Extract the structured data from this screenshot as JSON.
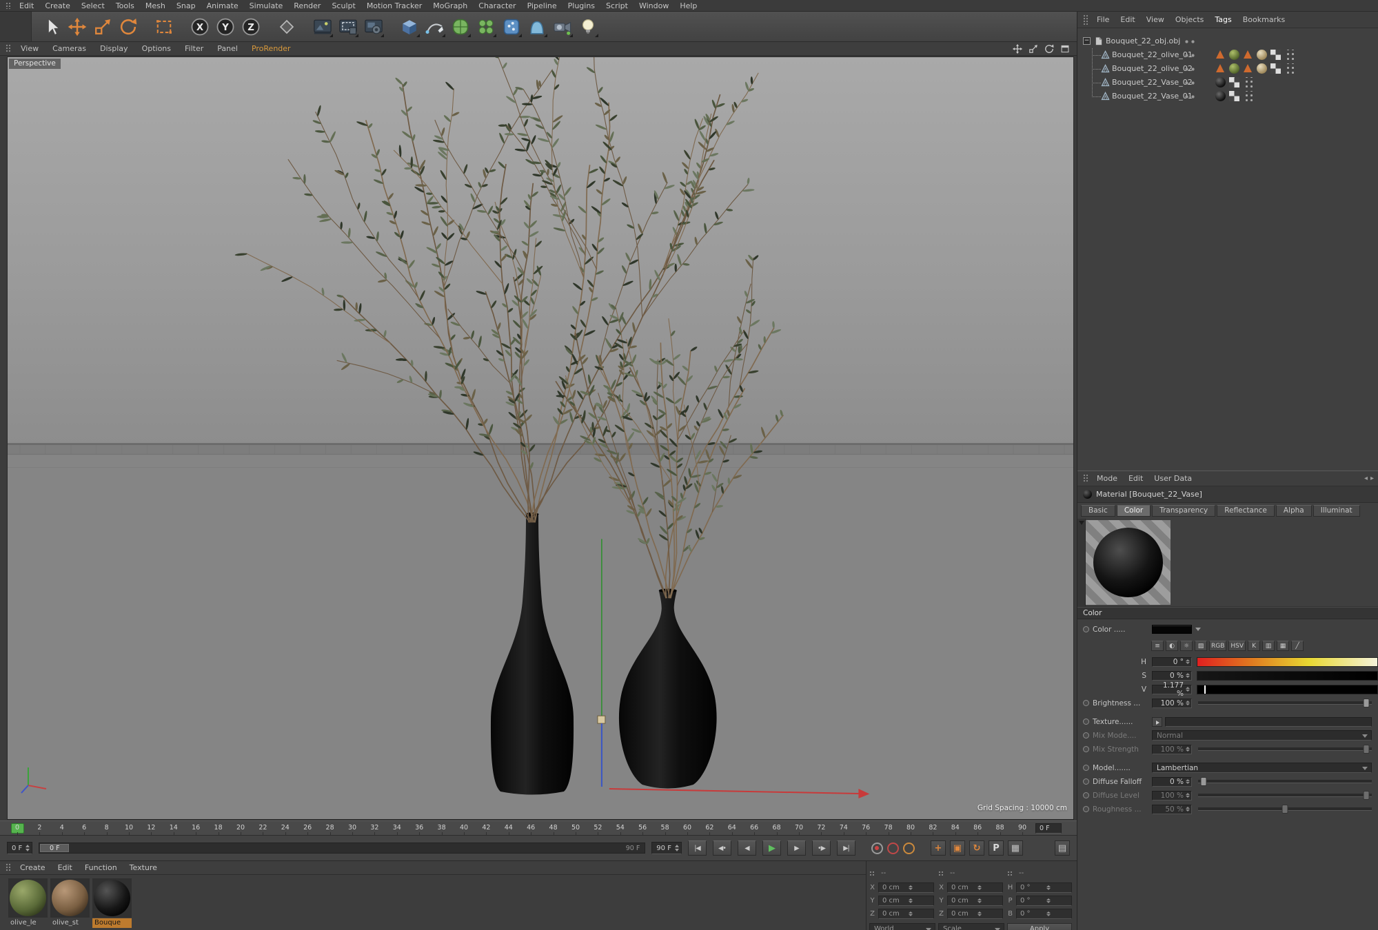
{
  "app": {
    "camera_label": "Perspective",
    "grid_spacing": "Grid Spacing : 10000 cm"
  },
  "colors": {
    "accent_orange": "#e0873c",
    "play_green": "#5fbf5f",
    "marker_green": "#56b34e",
    "selected_material_highlight": "#bd7b2e"
  },
  "menubar": {
    "items": [
      "Edit",
      "Create",
      "Select",
      "Tools",
      "Mesh",
      "Snap",
      "Animate",
      "Simulate",
      "Render",
      "Sculpt",
      "Motion Tracker",
      "MoGraph",
      "Character",
      "Pipeline",
      "Plugins",
      "Script",
      "Window",
      "Help"
    ]
  },
  "toolbar": {
    "icons": [
      {
        "name": "live-selection-tool",
        "kind": "cursor"
      },
      {
        "name": "move-tool",
        "kind": "move",
        "color": "#e0873c"
      },
      {
        "name": "scale-tool",
        "kind": "scale",
        "color": "#e0873c"
      },
      {
        "name": "rotate-tool",
        "kind": "rotate",
        "color": "#e0873c"
      },
      {
        "name": "last-used-tool",
        "kind": "recttool",
        "gap": true
      },
      {
        "name": "x-axis-lock",
        "kind": "axis",
        "label": "X",
        "gap": true
      },
      {
        "name": "y-axis-lock",
        "kind": "axis",
        "label": "Y"
      },
      {
        "name": "z-axis-lock",
        "kind": "axis",
        "label": "Z"
      },
      {
        "name": "coordinate-system-toggle",
        "kind": "coordsys",
        "gap": true
      },
      {
        "name": "render-view",
        "kind": "render",
        "gap": true,
        "fly": true
      },
      {
        "name": "render-region",
        "kind": "render2",
        "fly": true
      },
      {
        "name": "render-settings",
        "kind": "render3",
        "fly": true
      },
      {
        "name": "add-cube-object",
        "kind": "cube",
        "gap": true,
        "fly": true
      },
      {
        "name": "add-spline-pen",
        "kind": "pen",
        "fly": true
      },
      {
        "name": "add-subdivision-surface",
        "kind": "subdiv",
        "fly": true
      },
      {
        "name": "add-array-generator",
        "kind": "array",
        "fly": true
      },
      {
        "name": "add-volume",
        "kind": "volume",
        "fly": true
      },
      {
        "name": "add-deformer",
        "kind": "deformer",
        "fly": true
      },
      {
        "name": "add-camera",
        "kind": "camera",
        "fly": true
      },
      {
        "name": "add-light",
        "kind": "light",
        "fly": true
      }
    ]
  },
  "viewport_menu": {
    "items": [
      "View",
      "Cameras",
      "Display",
      "Options",
      "Filter",
      "Panel",
      "ProRender"
    ],
    "highlight": "ProRender",
    "view_icons": [
      {
        "name": "viewport-pan",
        "kind": "move"
      },
      {
        "name": "viewport-zoom",
        "kind": "scale"
      },
      {
        "name": "viewport-rotate",
        "kind": "rotate"
      },
      {
        "name": "viewport-toggle",
        "kind": "maximize"
      }
    ]
  },
  "object_manager": {
    "menu": [
      "File",
      "Edit",
      "View",
      "Objects",
      "Tags",
      "Bookmarks"
    ],
    "active": "Tags",
    "expand_glyph": "−",
    "rows": [
      {
        "name": "Bouquet_22_obj.obj",
        "root": true,
        "icon": "objfile",
        "tags": []
      },
      {
        "name": "Bouquet_22_olive_01",
        "icon": "mesh",
        "tags": [
          "tri",
          "matGreen",
          "tri",
          "matTan",
          "uvw",
          "dots"
        ]
      },
      {
        "name": "Bouquet_22_olive_02",
        "icon": "mesh",
        "tags": [
          "tri",
          "matGreen",
          "tri",
          "matTan",
          "uvw",
          "dots"
        ]
      },
      {
        "name": "Bouquet_22_Vase_02",
        "icon": "mesh",
        "tags": [
          "matBlack",
          "uvw",
          "dots"
        ]
      },
      {
        "name": "Bouquet_22_Vase_01",
        "icon": "mesh",
        "tags": [
          "matBlack",
          "uvw",
          "dots"
        ]
      }
    ]
  },
  "attributes": {
    "menu": [
      "Mode",
      "Edit",
      "User Data"
    ],
    "nav_back": "◂",
    "nav_fwd": "▸",
    "title": "Material [Bouquet_22_Vase]",
    "tabs": [
      "Basic",
      "Color",
      "Transparency",
      "Reflectance",
      "Alpha",
      "Illuminat"
    ],
    "active_tab": "Color",
    "section": "Color",
    "color_tools": [
      {
        "name": "compact-toggle-icon",
        "glyph": "≡"
      },
      {
        "name": "color-wheel-icon",
        "glyph": "◐"
      },
      {
        "name": "spectrum-icon",
        "glyph": "☼"
      },
      {
        "name": "picture-icon",
        "glyph": "▨"
      },
      {
        "name": "rgb-mode-button",
        "glyph": "RGB"
      },
      {
        "name": "hsv-mode-button",
        "glyph": "HSV"
      },
      {
        "name": "kelvin-mode-button",
        "glyph": "K"
      },
      {
        "name": "mixer-icon",
        "glyph": "▥"
      },
      {
        "name": "swatches-icon",
        "glyph": "▦"
      },
      {
        "name": "picker-icon",
        "glyph": "╱"
      }
    ],
    "params": [
      {
        "name": "color",
        "label": "Color .....",
        "type": "swatch",
        "dot": true
      },
      {
        "name": "color-tools",
        "type": "icons"
      },
      {
        "name": "hue",
        "label": "H",
        "short": true,
        "value": "0 °",
        "type": "gradient",
        "gradient": "hue"
      },
      {
        "name": "saturation",
        "label": "S",
        "short": true,
        "value": "0 %",
        "type": "gradient",
        "gradient": "sat"
      },
      {
        "name": "value",
        "label": "V",
        "short": true,
        "value": "1.177 %",
        "type": "gradient",
        "gradient": "val",
        "marker": 0.04
      },
      {
        "name": "brightness",
        "label": "Brightness ...",
        "value": "100 %",
        "type": "slider",
        "pos": 0.97,
        "dot": true
      },
      {
        "name": "texture",
        "label": "Texture......",
        "type": "texture",
        "dot": true,
        "gap": true
      },
      {
        "name": "mix-mode",
        "label": "Mix Mode....",
        "value": "Normal",
        "type": "dropdown",
        "disabled": true,
        "dot": true
      },
      {
        "name": "mix-strength",
        "label": "Mix Strength",
        "value": "100 %",
        "type": "slider",
        "pos": 0.97,
        "disabled": true,
        "dot": true
      },
      {
        "name": "model",
        "label": "Model.......",
        "value": "Lambertian",
        "type": "dropdown",
        "dot": true,
        "gap": true
      },
      {
        "name": "diffuse-falloff",
        "label": "Diffuse Falloff",
        "value": "0 %",
        "type": "slider",
        "pos": 0.03,
        "dot": true
      },
      {
        "name": "diffuse-level",
        "label": "Diffuse Level",
        "value": "100 %",
        "type": "slider",
        "pos": 0.97,
        "disabled": true,
        "dot": true
      },
      {
        "name": "roughness",
        "label": "Roughness ...",
        "value": "50 %",
        "type": "slider",
        "pos": 0.5,
        "disabled": true,
        "dot": true
      }
    ]
  },
  "timeline": {
    "labels": [
      "0",
      "2",
      "4",
      "6",
      "8",
      "10",
      "12",
      "14",
      "16",
      "18",
      "20",
      "22",
      "24",
      "26",
      "28",
      "30",
      "32",
      "34",
      "36",
      "38",
      "40",
      "42",
      "44",
      "46",
      "48",
      "50",
      "52",
      "54",
      "56",
      "58",
      "60",
      "62",
      "64",
      "66",
      "68",
      "70",
      "72",
      "74",
      "76",
      "78",
      "80",
      "82",
      "84",
      "86",
      "88",
      "90"
    ],
    "frame_box": "0 F"
  },
  "playbar": {
    "start": "0 F",
    "handle": "0 F",
    "range_end": "90 F",
    "end": "90 F",
    "transport": [
      {
        "name": "goto-start-button",
        "glyph": "|◀"
      },
      {
        "name": "prev-key-button",
        "glyph": "◀•"
      },
      {
        "name": "prev-frame-button",
        "glyph": "◀"
      },
      {
        "name": "play-button",
        "glyph": "▶",
        "play": true
      },
      {
        "name": "next-frame-button",
        "glyph": "▶"
      },
      {
        "name": "next-key-button",
        "glyph": "•▶"
      },
      {
        "name": "goto-end-button",
        "glyph": "▶|"
      }
    ],
    "records": [
      {
        "name": "record-keyframe-button",
        "style": "key"
      },
      {
        "name": "autokey-button",
        "style": "red"
      },
      {
        "name": "autokey-objects-button",
        "style": "orange"
      }
    ],
    "tools": [
      {
        "name": "mini-move-icon",
        "glyph": "+",
        "color": "#e0873c"
      },
      {
        "name": "mini-scale-icon",
        "glyph": "▣",
        "color": "#e0873c"
      },
      {
        "name": "mini-rotate-icon",
        "glyph": "↻",
        "color": "#e0873c"
      },
      {
        "name": "coords-toggle-button",
        "glyph": "P",
        "color": "#d8d8d8"
      },
      {
        "name": "snap-grid-button",
        "glyph": "▦",
        "color": "#c0c0c0"
      }
    ],
    "panel_icon": {
      "name": "layout-panel-button",
      "glyph": "▤",
      "color": "#c0c0c0"
    }
  },
  "materials": {
    "menu": [
      "Create",
      "Edit",
      "Function",
      "Texture"
    ],
    "items": [
      {
        "label": "olive_le",
        "selected": false,
        "ball": [
          "#9aa86a",
          "#5a6a38",
          "#2c3418"
        ]
      },
      {
        "label": "olive_st",
        "selected": false,
        "ball": [
          "#b89878",
          "#7a5f42",
          "#3c2d1c"
        ]
      },
      {
        "label": "Bouque",
        "selected": true,
        "ball": [
          "#555555",
          "#161616",
          "#000000"
        ]
      }
    ]
  },
  "coordinates": {
    "columns": [
      {
        "header": "--",
        "rows": [
          [
            "X",
            "0 cm"
          ],
          [
            "Y",
            "0 cm"
          ],
          [
            "Z",
            "0 cm"
          ]
        ]
      },
      {
        "header": "--",
        "rows": [
          [
            "X",
            "0 cm"
          ],
          [
            "Y",
            "0 cm"
          ],
          [
            "Z",
            "0 cm"
          ]
        ]
      },
      {
        "header": "--",
        "rows": [
          [
            "H",
            "0 °"
          ],
          [
            "P",
            "0 °"
          ],
          [
            "B",
            "0 °"
          ]
        ]
      }
    ],
    "footer": [
      "World",
      "Scale",
      "Apply"
    ]
  }
}
